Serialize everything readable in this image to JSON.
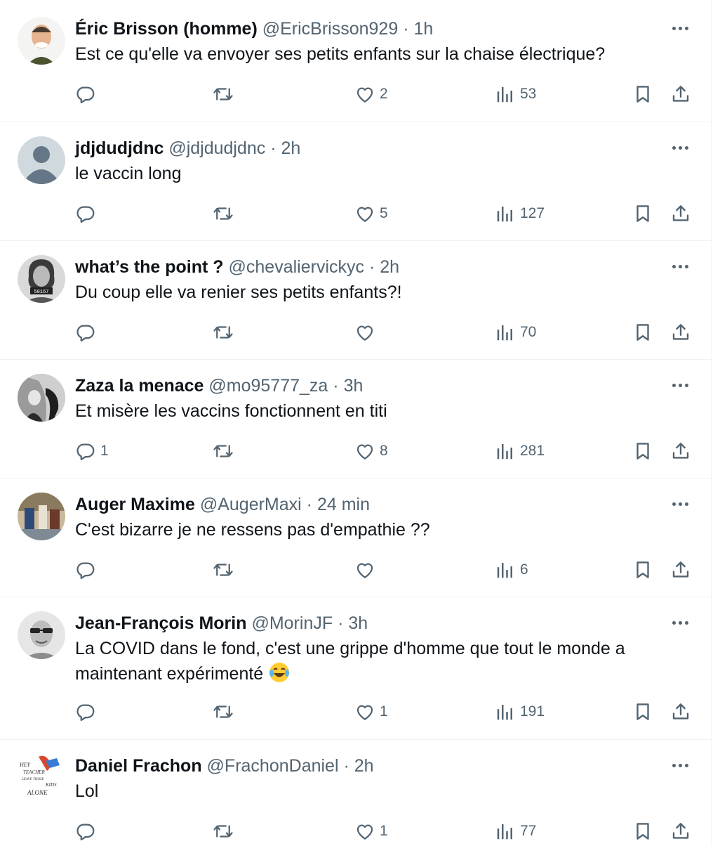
{
  "tweets": [
    {
      "name": "Éric Brisson (homme)",
      "handle": "@EricBrisson929",
      "time": "1h",
      "text": "Est ce qu'elle va envoyer ses petits enfants sur la chaise électrique?",
      "replies": "",
      "likes": "2",
      "views": "53"
    },
    {
      "name": "jdjdudjdnc",
      "handle": "@jdjdudjdnc",
      "time": "2h",
      "text": "le vaccin long",
      "replies": "",
      "likes": "5",
      "views": "127"
    },
    {
      "name": "what’s the point ?",
      "handle": "@chevaliervickyc",
      "time": "2h",
      "text": "Du coup elle va renier ses petits enfants?!",
      "replies": "",
      "likes": "",
      "views": "70",
      "avatar_badge": "50167"
    },
    {
      "name": "Zaza la menace",
      "handle": "@mo95777_za",
      "time": "3h",
      "text": "Et misère les vaccins fonctionnent en titi",
      "replies": "1",
      "likes": "8",
      "views": "281"
    },
    {
      "name": "Auger Maxime",
      "handle": "@AugerMaxi",
      "time": "24 min",
      "text": "C'est bizarre je ne ressens pas d'empathie ??",
      "replies": "",
      "likes": "",
      "views": "6"
    },
    {
      "name": "Jean-François Morin",
      "handle": "@MorinJF",
      "time": "3h",
      "text_line1": "La COVID dans le fond, c'est une grippe d'homme que tout le monde a",
      "text_line2": "maintenant expérimenté",
      "replies": "",
      "likes": "1",
      "views": "191"
    },
    {
      "name": "Daniel Frachon",
      "handle": "@FrachonDaniel",
      "time": "2h",
      "text": "Lol",
      "replies": "",
      "likes": "1",
      "views": "77",
      "avatar_text": [
        "HEY",
        "TEACHER",
        "LEAVE THOSE",
        "KIDS",
        "ALONE"
      ]
    }
  ],
  "separator": "·",
  "colors": {
    "text": "#0f1419",
    "secondary": "#536471",
    "border": "#eff3f4"
  }
}
